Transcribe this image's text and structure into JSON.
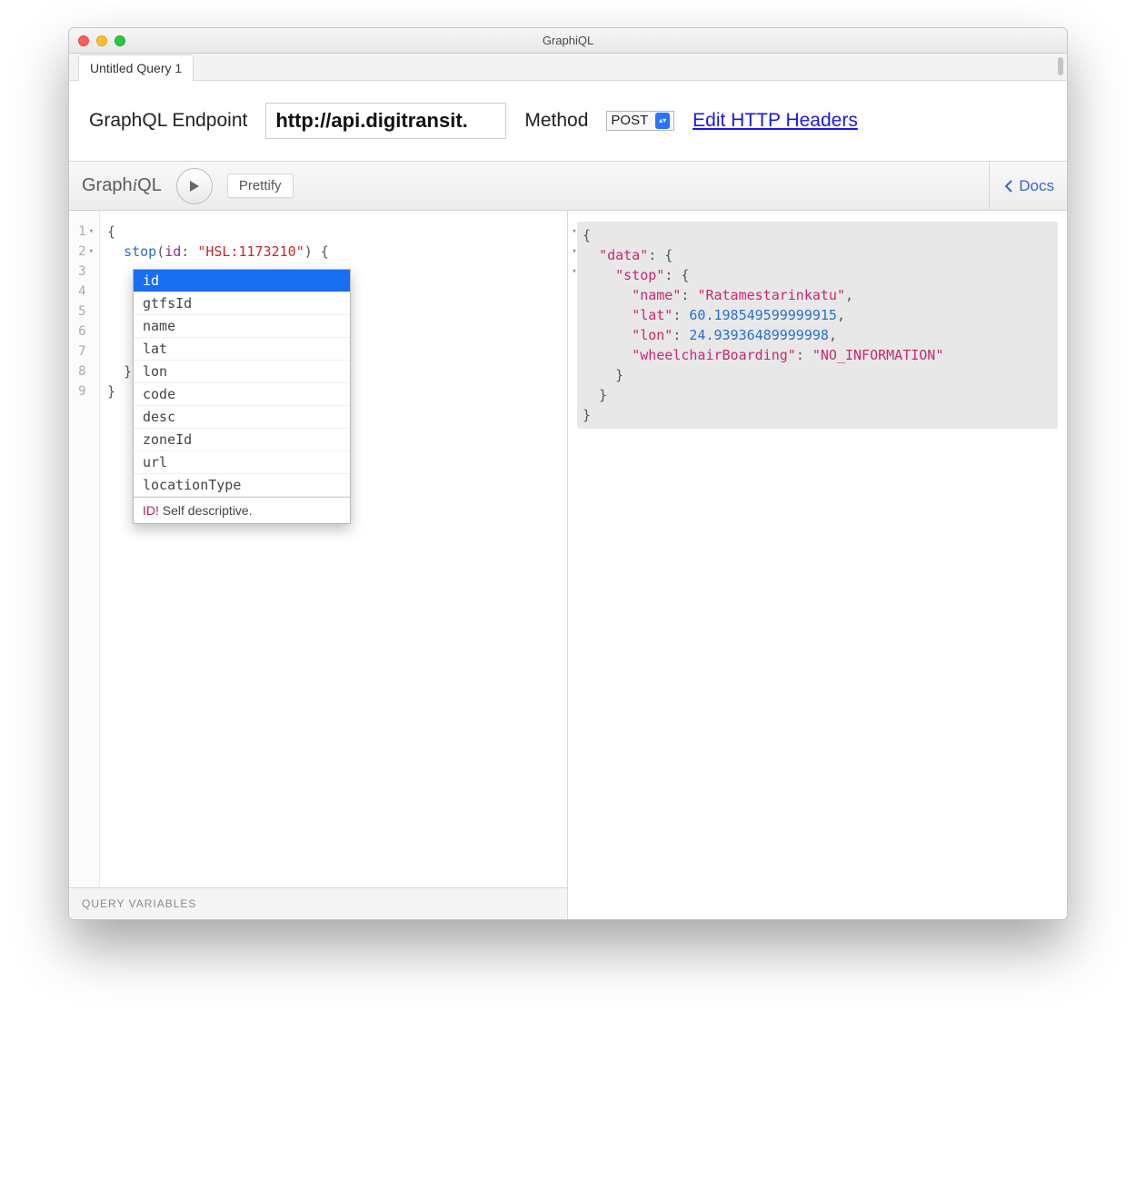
{
  "window": {
    "title": "GraphiQL"
  },
  "tab": {
    "label": "Untitled Query 1"
  },
  "endpoint": {
    "label": "GraphQL Endpoint",
    "value": "http://api.digitransit.",
    "method_label": "Method",
    "method_value": "POST",
    "edit_headers": "Edit HTTP Headers"
  },
  "toolbar": {
    "logo_prefix": "Graph",
    "logo_i": "i",
    "logo_suffix": "QL",
    "prettify": "Prettify",
    "docs": "Docs"
  },
  "editor": {
    "line_numbers": [
      "1",
      "2",
      "3",
      "4",
      "5",
      "6",
      "7",
      "8",
      "9"
    ],
    "code_tokens": {
      "l1": "{",
      "l2_field": "stop",
      "l2_arg": "id",
      "l2_str": "\"HSL:1173210\"",
      "l2_tail": ") {",
      "l8": "}",
      "l9": "}"
    }
  },
  "hints": {
    "options": [
      "id",
      "gtfsId",
      "name",
      "lat",
      "lon",
      "code",
      "desc",
      "zoneId",
      "url",
      "locationType"
    ],
    "selected_index": 0,
    "descr_type": "ID!",
    "descr_text": "Self descriptive."
  },
  "query_variables_label": "Query Variables",
  "result": {
    "data_key": "\"data\"",
    "stop_key": "\"stop\"",
    "fields": {
      "name_key": "\"name\"",
      "name_val": "\"Ratamestarinkatu\"",
      "lat_key": "\"lat\"",
      "lat_val": "60.198549599999915",
      "lon_key": "\"lon\"",
      "lon_val": "24.93936489999998",
      "wc_key": "\"wheelchairBoarding\"",
      "wc_val": "\"NO_INFORMATION\""
    }
  }
}
